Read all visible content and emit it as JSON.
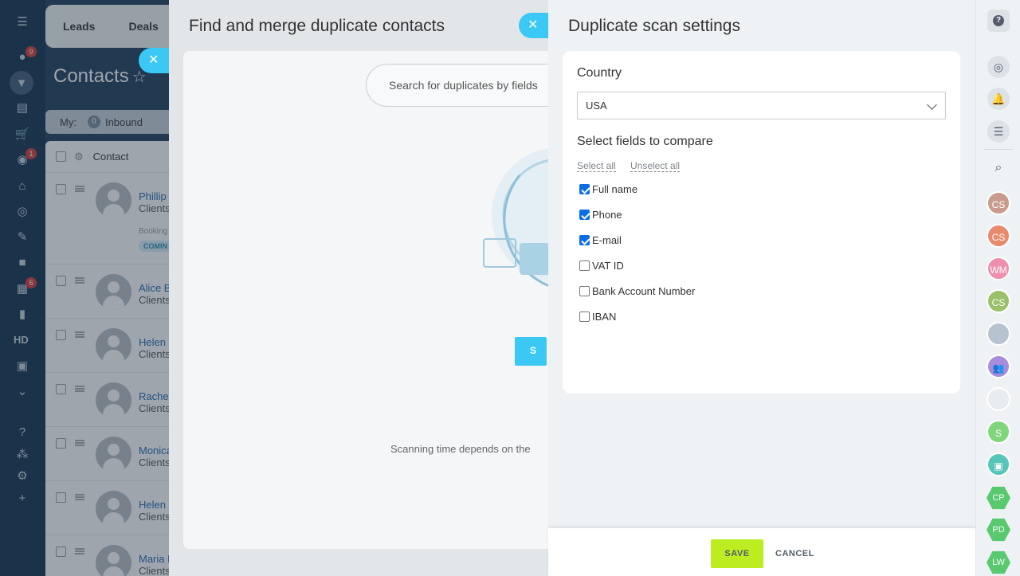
{
  "background_crm": {
    "tabs": [
      "Leads",
      "Deals"
    ],
    "title": "Contacts",
    "filter_my": "My:",
    "filter_count": "0",
    "filter_inbound": "Inbound",
    "column_contact": "Contact",
    "rows": [
      {
        "name": "Phillip",
        "sub": "Clients",
        "extra": "Booking",
        "tag": "COMIN"
      },
      {
        "name": "Alice B",
        "sub": "Clients"
      },
      {
        "name": "Helen",
        "sub": "Clients"
      },
      {
        "name": "Rachel",
        "sub": "Clients"
      },
      {
        "name": "Monica",
        "sub": "Clients"
      },
      {
        "name": "Helen S",
        "sub": "Clients"
      },
      {
        "name": "Maria D",
        "sub": "Clients"
      }
    ]
  },
  "left_nav": {
    "badges": [
      "9",
      "1",
      "6"
    ],
    "hd_label": "HD"
  },
  "merge_panel": {
    "title": "Find and merge duplicate contacts",
    "search_placeholder": "Search for duplicates by fields",
    "button_partial": "S",
    "note": "Scanning time depends on the"
  },
  "settings_panel": {
    "title": "Duplicate scan settings",
    "country_label": "Country",
    "country_value": "USA",
    "fields_label": "Select fields to compare",
    "select_all": "Select all",
    "unselect_all": "Unselect all",
    "fields": [
      {
        "label": "Full name",
        "checked": true
      },
      {
        "label": "Phone",
        "checked": true
      },
      {
        "label": "E-mail",
        "checked": true
      },
      {
        "label": "VAT ID",
        "checked": false
      },
      {
        "label": "Bank Account Number",
        "checked": false
      },
      {
        "label": "IBAN",
        "checked": false
      }
    ],
    "save_label": "SAVE",
    "cancel_label": "CANCEL"
  },
  "right_bar": {
    "avatars": [
      {
        "initials": "CS",
        "color": "#c89b8c"
      },
      {
        "initials": "CS",
        "color": "#e98a6f"
      },
      {
        "initials": "WM",
        "color": "#ef8fb0"
      },
      {
        "initials": "CS",
        "color": "#9ac16a"
      },
      {
        "initials": "",
        "color": "#b7c3cf"
      },
      {
        "initials": "",
        "color": "#a78bdc"
      },
      {
        "initials": "",
        "color": "#e8ecef"
      },
      {
        "initials": "S",
        "color": "#7fd67c"
      },
      {
        "initials": "",
        "color": "#56c6b8"
      }
    ],
    "hex_avatars": [
      "CP",
      "PD",
      "LW"
    ]
  },
  "colors": {
    "accent_blue": "#3bc8f5",
    "save_green": "#bbed21",
    "checkbox_blue": "#0b6ee6"
  }
}
